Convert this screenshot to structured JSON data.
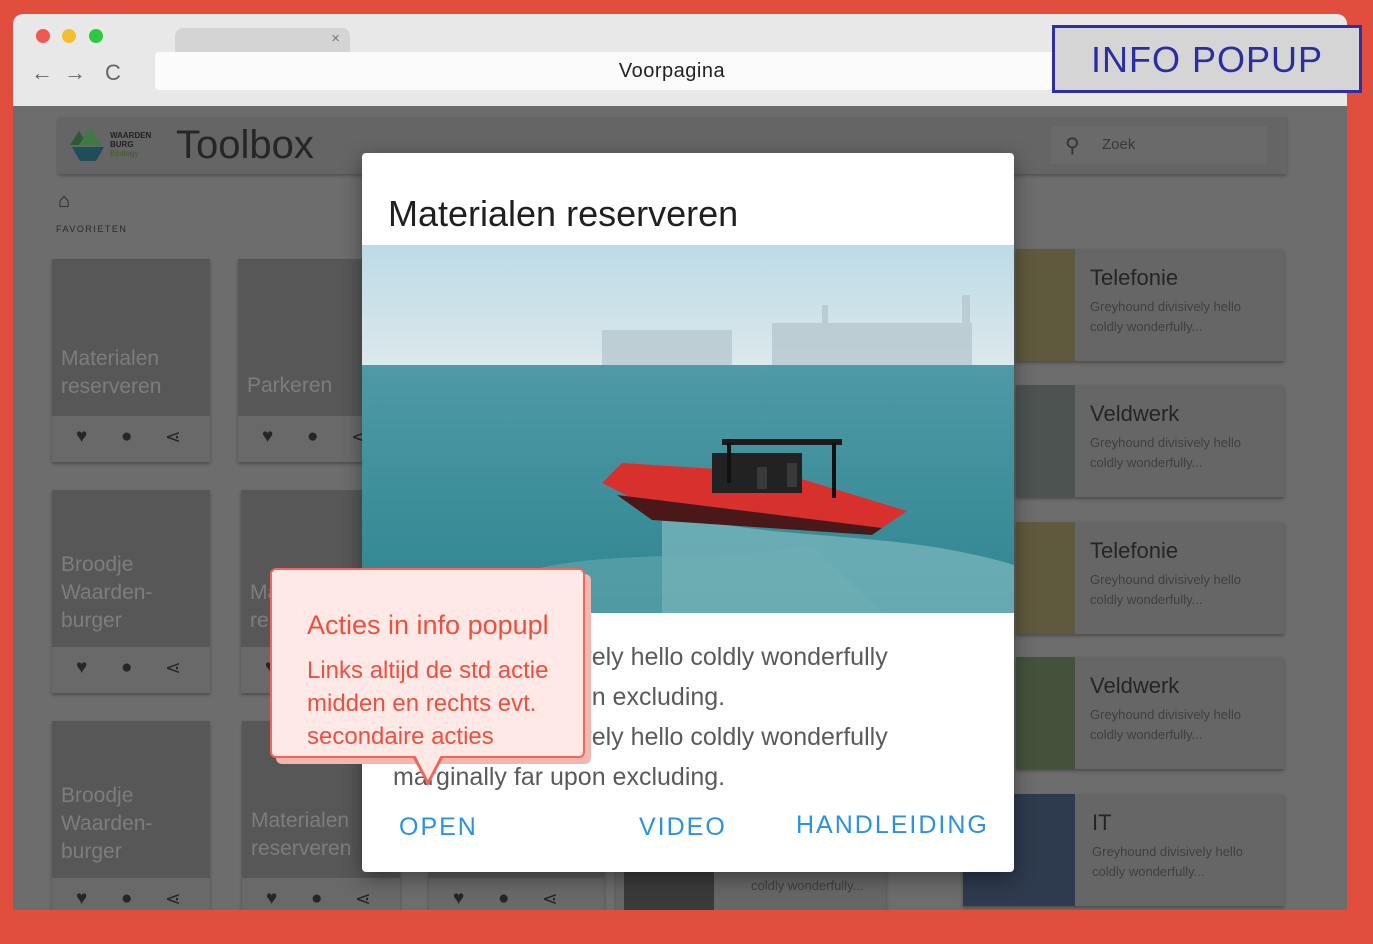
{
  "browser": {
    "url": "Voorpagina",
    "tab_close": "×",
    "back": "←",
    "forward": "→",
    "reload": "C"
  },
  "screen_label": "INFO POPUP",
  "app": {
    "logo_line1": "WAARDEN",
    "logo_line2": "BURG",
    "logo_line3": "Ecology",
    "title": "Toolbox",
    "search_placeholder": "Zoek",
    "favorites_label": "FAVORIETEN"
  },
  "tiles": [
    {
      "title": "Materialen reserveren"
    },
    {
      "title": "Parkeren"
    },
    {
      "title": "Broodje Waarden-burger"
    },
    {
      "title": "Ma re"
    },
    {
      "title": "Broodje Waarden-burger"
    },
    {
      "title": "Materialen reserveren"
    }
  ],
  "list_cards": [
    {
      "title": "Telefonie",
      "desc": "Greyhound divisively hello coldly wonderfully..."
    },
    {
      "title": "Veldwerk",
      "desc": "Greyhound divisively hello coldly wonderfully..."
    },
    {
      "title": "Telefonie",
      "desc": "Greyhound divisively hello coldly wonderfully..."
    },
    {
      "title": "Veldwerk",
      "desc": "Greyhound divisively hello coldly wonderfully..."
    },
    {
      "title": "IT",
      "desc": "Greyhound divisively hello coldly wonderfully..."
    }
  ],
  "hidden_card_text": "coldly wonderfully...",
  "modal": {
    "title": "Materialen reserveren",
    "body_line1": "Greyhound divisively hello coldly wonderfully",
    "body_line2": "marginally far upon excluding.",
    "body_line3": "Greyhound divisively hello coldly wonderfully",
    "body_line4": "marginally far upon excluding.",
    "btn_open": "OPEN",
    "btn_video": "VIDEO",
    "btn_manual": "HANDLEIDING"
  },
  "callout": {
    "heading": "Acties in info popupl",
    "body": "Links altijd de std actie midden en rechts evt. secondaire acties"
  },
  "colors": {
    "frame": "#e24e3e",
    "accent_blue": "#2b91e3",
    "callout_text": "#ee4f3f",
    "label_blue": "#2b2e9f"
  }
}
